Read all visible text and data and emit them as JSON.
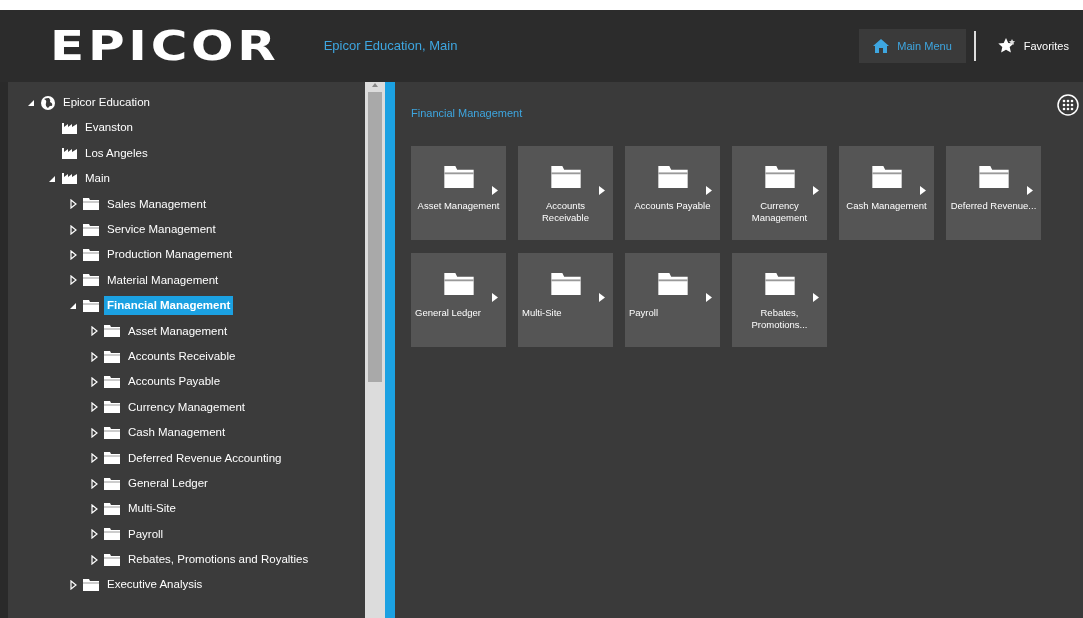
{
  "header": {
    "logo": "EPICOR",
    "company": "Epicor Education, Main",
    "buttons": [
      {
        "label": "Main Menu",
        "kind": "home",
        "selected": true
      },
      {
        "label": "Favorites",
        "kind": "favorites",
        "selected": false
      }
    ]
  },
  "tree": [
    {
      "label": "Epicor Education",
      "kind": "company",
      "expanded": true,
      "selected": false,
      "children": [
        {
          "label": "Evanston",
          "kind": "site",
          "selected": false
        },
        {
          "label": "Los Angeles",
          "kind": "site",
          "selected": false
        },
        {
          "label": "Main",
          "kind": "site",
          "expanded": true,
          "selected": false,
          "children": [
            {
              "label": "Sales Management",
              "kind": "folder",
              "expanded": false,
              "selected": false
            },
            {
              "label": "Service Management",
              "kind": "folder",
              "expanded": false,
              "selected": false
            },
            {
              "label": "Production Management",
              "kind": "folder",
              "expanded": false,
              "selected": false
            },
            {
              "label": "Material Management",
              "kind": "folder",
              "expanded": false,
              "selected": false
            },
            {
              "label": "Financial Management",
              "kind": "folder",
              "expanded": true,
              "selected": true,
              "children": [
                {
                  "label": "Asset Management",
                  "kind": "folder",
                  "expanded": false,
                  "selected": false
                },
                {
                  "label": "Accounts Receivable",
                  "kind": "folder",
                  "expanded": false,
                  "selected": false
                },
                {
                  "label": "Accounts Payable",
                  "kind": "folder",
                  "expanded": false,
                  "selected": false
                },
                {
                  "label": "Currency Management",
                  "kind": "folder",
                  "expanded": false,
                  "selected": false
                },
                {
                  "label": "Cash Management",
                  "kind": "folder",
                  "expanded": false,
                  "selected": false
                },
                {
                  "label": "Deferred Revenue Accounting",
                  "kind": "folder",
                  "expanded": false,
                  "selected": false
                },
                {
                  "label": "General Ledger",
                  "kind": "folder",
                  "expanded": false,
                  "selected": false
                },
                {
                  "label": "Multi-Site",
                  "kind": "folder",
                  "expanded": false,
                  "selected": false
                },
                {
                  "label": "Payroll",
                  "kind": "folder",
                  "expanded": false,
                  "selected": false
                },
                {
                  "label": "Rebates, Promotions and Royalties",
                  "kind": "folder",
                  "expanded": false,
                  "selected": false
                }
              ]
            },
            {
              "label": "Executive Analysis",
              "kind": "folder",
              "expanded": false,
              "selected": false
            }
          ]
        }
      ]
    }
  ],
  "content": {
    "title": "Financial Management",
    "tiles": [
      {
        "label": "Asset Management"
      },
      {
        "label": "Accounts Receivable"
      },
      {
        "label": "Accounts Payable"
      },
      {
        "label": "Currency Management"
      },
      {
        "label": "Cash Management"
      },
      {
        "label": "Deferred Revenue..."
      },
      {
        "label": "General Ledger"
      },
      {
        "label": "Multi-Site"
      },
      {
        "label": "Payroll"
      },
      {
        "label": "Rebates, Promotions..."
      }
    ]
  }
}
